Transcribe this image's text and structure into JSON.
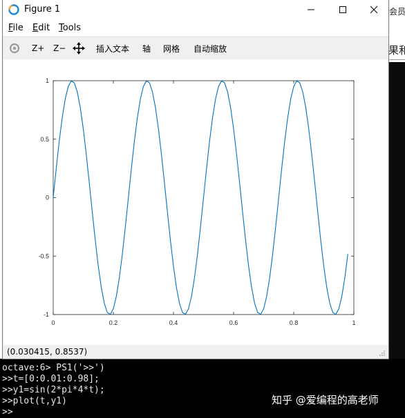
{
  "window": {
    "title": "Figure 1",
    "controls": [
      "minimize",
      "maximize",
      "close"
    ]
  },
  "menu": [
    {
      "label": "File",
      "mnemonic": "F",
      "rest": "ile"
    },
    {
      "label": "Edit",
      "mnemonic": "E",
      "rest": "dit"
    },
    {
      "label": "Tools",
      "mnemonic": "T",
      "rest": "ools"
    }
  ],
  "toolbar": {
    "zoom_in": "Z+",
    "zoom_out": "Z−",
    "insert_text": "插入文本",
    "axis": "轴",
    "grid": "网格",
    "autoscale": "自动缩放"
  },
  "status": {
    "coordinates": "(0.030415, 0.8537)"
  },
  "background": {
    "text_a": "会员购",
    "text_b": "果和"
  },
  "terminal": {
    "lines": [
      "octave:6> PS1('>>')",
      ">>t=[0:0.01:0.98];",
      ">>y1=sin(2*pi*4*t);",
      ">>plot(t,y1)",
      ">>"
    ]
  },
  "watermark": "知乎 @爱编程的高老师",
  "chart_data": {
    "type": "line",
    "title": "",
    "xlabel": "",
    "ylabel": "",
    "xlim": [
      0,
      1
    ],
    "ylim": [
      -1,
      1
    ],
    "xticks": [
      "0",
      "0.2",
      "0.4",
      "0.6",
      "0.8",
      "1"
    ],
    "yticks": [
      "-1",
      "-0.5",
      "0",
      "0.5",
      "1"
    ],
    "grid": false,
    "series": [
      {
        "color": "#0072bd",
        "x_start": 0,
        "x_step": 0.01,
        "x_end": 0.98,
        "formula": "sin(2*pi*4*t)"
      }
    ]
  }
}
